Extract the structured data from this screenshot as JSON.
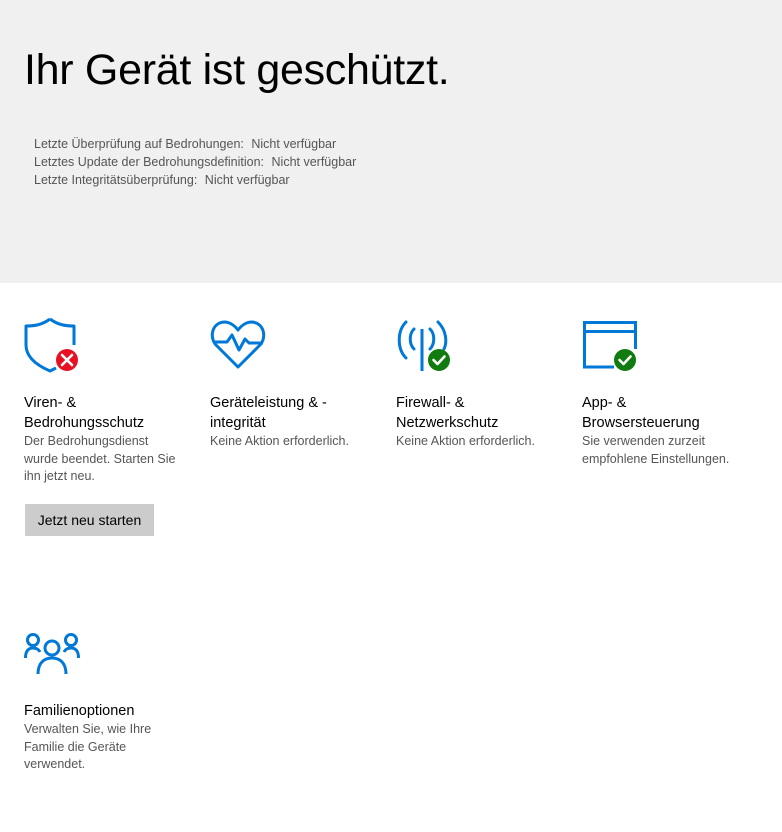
{
  "header": {
    "title": "Ihr Gerät ist geschützt.",
    "status": [
      {
        "label": "Letzte Überprüfung auf Bedrohungen:",
        "value": "Nicht verfügbar"
      },
      {
        "label": "Letztes Update der Bedrohungsdefinition:",
        "value": "Nicht verfügbar"
      },
      {
        "label": "Letzte Integritätsüberprüfung:",
        "value": "Nicht verfügbar"
      }
    ]
  },
  "tiles": {
    "virus": {
      "title_line1": "Viren- &",
      "title_line2": "Bedrohungsschutz",
      "desc": "Der Bedrohungsdienst wurde beendet. Starten Sie ihn jetzt neu.",
      "button": "Jetzt neu starten",
      "icon": "shield-icon",
      "badge": "error-badge-icon"
    },
    "device": {
      "title_line1": "Geräteleistung & -",
      "title_line2": "integrität",
      "desc": "Keine Aktion erforderlich.",
      "icon": "heart-pulse-icon"
    },
    "firewall": {
      "title_line1": "Firewall- &",
      "title_line2": "Netzwerkschutz",
      "desc": "Keine Aktion erforderlich.",
      "icon": "antenna-icon",
      "badge": "check-badge-icon"
    },
    "app": {
      "title_line1": "App- &",
      "title_line2": "Browsersteuerung",
      "desc": "Sie verwenden zurzeit empfohlene Einstellungen.",
      "icon": "browser-window-icon",
      "badge": "check-badge-icon"
    },
    "family": {
      "title_line1": "Familienoptionen",
      "desc": "Verwalten Sie, wie Ihre Familie die Geräte verwendet.",
      "icon": "family-icon"
    }
  },
  "colors": {
    "accent": "#0078d7",
    "error": "#e81123",
    "ok": "#107c10",
    "header_bg": "#f0f0f0",
    "button_bg": "#cccccc"
  }
}
